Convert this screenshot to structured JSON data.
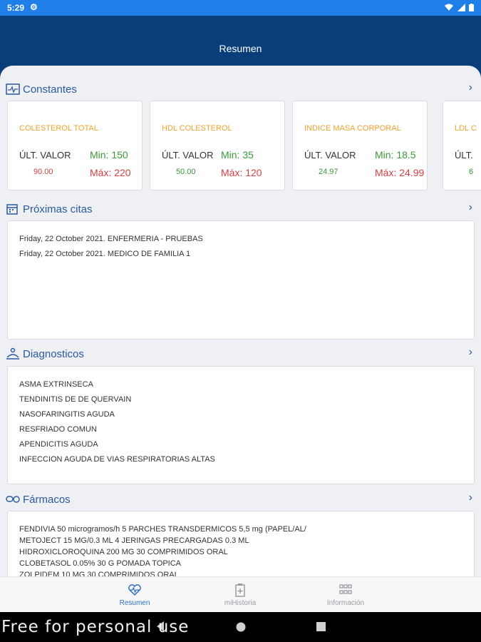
{
  "status_bar": {
    "time": "5:29",
    "settings_icon": "gear-icon",
    "right_icons": "wifi, signal, battery"
  },
  "app_bar": {
    "title": "Resumen"
  },
  "constantes": {
    "title": "Constantes",
    "icon": "chart-icon",
    "cards": [
      {
        "title": "COLESTEROL TOTAL",
        "ult_label": "ÚLT. VALOR",
        "value": "90.00",
        "value_color": "#d84040",
        "min": "Min: 150",
        "max": "Máx: 220"
      },
      {
        "title": "HDL COLESTEROL",
        "ult_label": "ÚLT. VALOR",
        "value": "50.00",
        "value_color": "#3a9a3a",
        "min": "Min: 35",
        "max": "Máx: 120"
      },
      {
        "title": "INDICE MASA CORPORAL",
        "ult_label": "ÚLT. VALOR",
        "value": "24.97",
        "value_color": "#3a9a3a",
        "min": "Min: 18.5",
        "max": "Máx: 24.99"
      },
      {
        "title": "LDL C",
        "ult_label": "ÚLT.",
        "value": "6",
        "value_color": "#3a9a3a",
        "min": "",
        "max": ""
      }
    ]
  },
  "citas": {
    "title": "Próximas citas",
    "icon": "calendar-icon",
    "items": [
      "Friday, 22 October 2021. ENFERMERIA - PRUEBAS",
      "Friday, 22 October 2021. MEDICO DE FAMILIA 1"
    ]
  },
  "diagnosticos": {
    "title": "Diagnosticos",
    "icon": "stethoscope-icon",
    "items": [
      "ASMA EXTRINSECA",
      "TENDINITIS DE DE QUERVAIN",
      "NASOFARINGITIS AGUDA",
      "RESFRIADO COMUN",
      "APENDICITIS AGUDA",
      "INFECCION AGUDA DE VIAS RESPIRATORIAS ALTAS"
    ]
  },
  "farmacos": {
    "title": "Fármacos",
    "icon": "pills-icon",
    "items": [
      "FENDIVIA 50 microgramos/h 5 PARCHES TRANSDERMICOS 5,5 mg (PAPEL/AL/",
      "METOJECT 15 MG/0.3 ML 4 JERINGAS PRECARGADAS 0.3 ML",
      "HIDROXICLOROQUINA 200 MG 30 COMPRIMIDOS ORAL",
      "CLOBETASOL 0.05% 30 G POMADA TOPICA",
      "ZOLPIDEM 10 MG 30 COMPRIMIDOS ORAL"
    ]
  },
  "bottom_nav": {
    "items": [
      {
        "label": "Resumen",
        "icon": "heart-pulse-icon",
        "active": true
      },
      {
        "label": "miHistoria",
        "icon": "clipboard-plus-icon",
        "active": false
      },
      {
        "label": "Información",
        "icon": "grid-icon",
        "active": false
      }
    ]
  },
  "watermark": "Free for personal use",
  "colors": {
    "primary": "#0a3e7a",
    "status_bar": "#1f7ee8",
    "accent_title": "#f0a22e",
    "min": "#3a9a3a",
    "max": "#d84040",
    "active_nav": "#2b6fc0"
  }
}
